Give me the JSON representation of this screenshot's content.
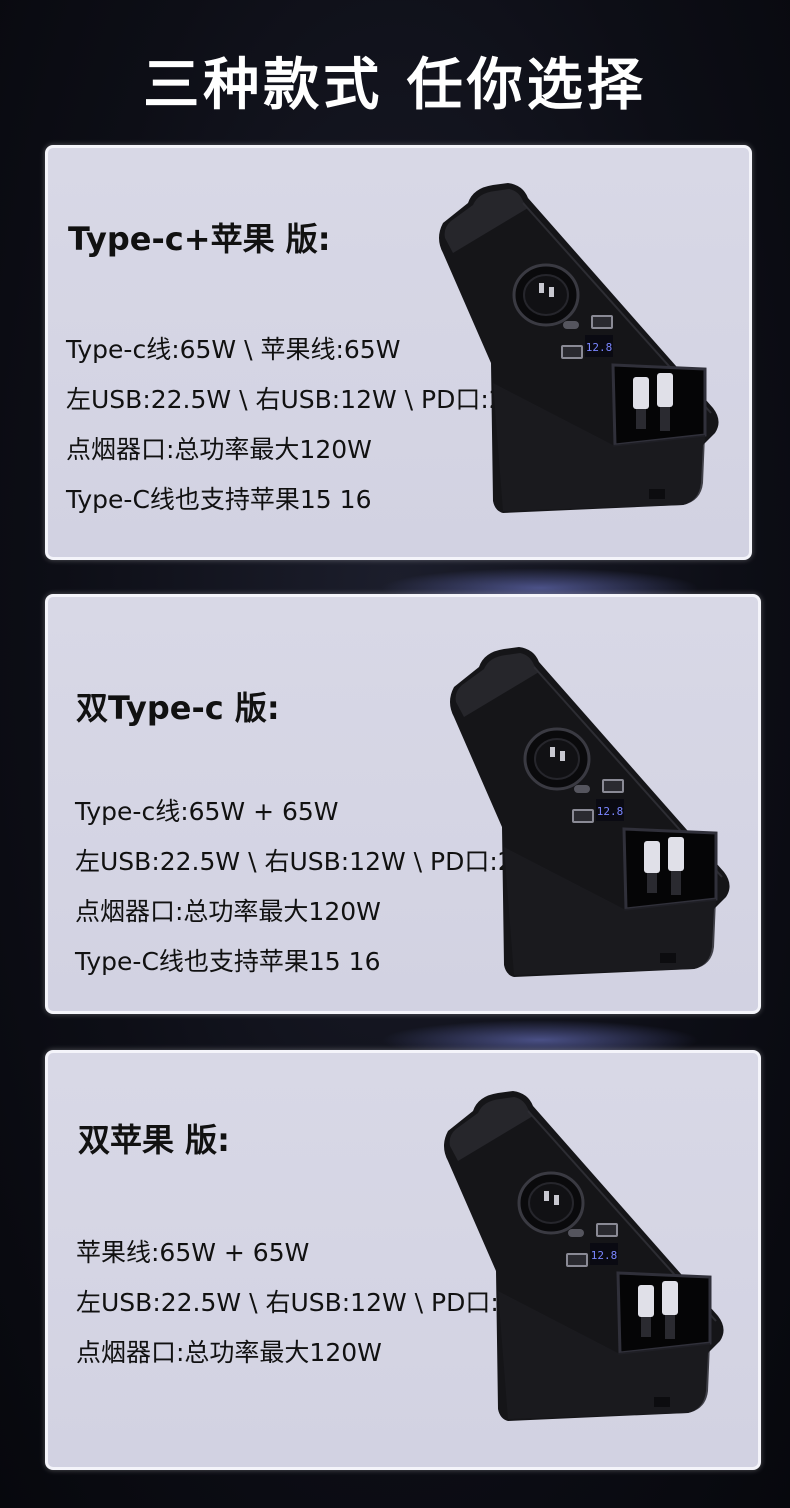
{
  "headline": "三种款式  任你选择",
  "cards": [
    {
      "title": "Type-c+苹果 版:",
      "specs": [
        "Type-c线:65W \\ 苹果线:65W",
        "左USB:22.5W \\ 右USB:12W \\ PD口:27W",
        "点烟器口:总功率最大120W",
        "Type-C线也支持苹果15 16"
      ],
      "display": "12.8"
    },
    {
      "title": "双Type-c 版:",
      "specs": [
        "Type-c线:65W + 65W",
        "左USB:22.5W \\ 右USB:12W \\ PD口:27W",
        "点烟器口:总功率最大120W",
        "Type-C线也支持苹果15 16"
      ],
      "display": "12.8"
    },
    {
      "title": "双苹果 版:",
      "specs": [
        "苹果线:65W + 65W",
        "左USB:22.5W \\ 右USB:12W \\ PD口:27W",
        "点烟器口:总功率最大120W"
      ],
      "display": "12.8"
    }
  ]
}
